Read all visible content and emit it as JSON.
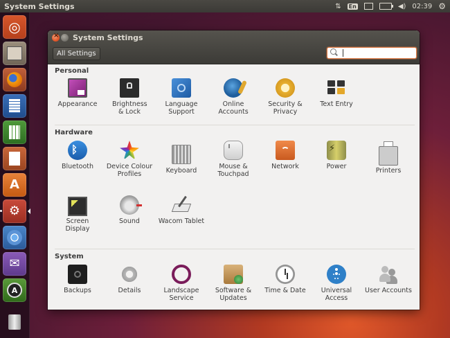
{
  "top_panel": {
    "title": "System Settings",
    "keyboard_layout": "En",
    "clock": "02:39"
  },
  "launcher": {
    "items": [
      {
        "name": "dash-home",
        "icon": "ubuntu-logo-icon"
      },
      {
        "name": "files",
        "icon": "file-cabinet-icon"
      },
      {
        "name": "firefox",
        "icon": "firefox-icon"
      },
      {
        "name": "libreoffice-writer",
        "icon": "document-icon"
      },
      {
        "name": "libreoffice-calc",
        "icon": "spreadsheet-icon"
      },
      {
        "name": "libreoffice-impress",
        "icon": "presentation-icon"
      },
      {
        "name": "ubuntu-software-center",
        "icon": "shopping-bag-icon"
      },
      {
        "name": "system-settings",
        "icon": "gear-wrench-icon"
      },
      {
        "name": "chromium",
        "icon": "chromium-icon"
      },
      {
        "name": "empathy",
        "icon": "chat-bird-icon"
      },
      {
        "name": "software-updater",
        "icon": "updater-icon"
      },
      {
        "name": "trash",
        "icon": "trash-icon"
      }
    ]
  },
  "window": {
    "title": "System Settings",
    "all_settings_label": "All Settings",
    "search": {
      "value": "",
      "placeholder": ""
    }
  },
  "sections": {
    "personal": {
      "title": "Personal",
      "items": [
        {
          "label": "Appearance",
          "icon": "appearance-icon"
        },
        {
          "label": "Brightness & Lock",
          "icon": "brightness-lock-icon"
        },
        {
          "label": "Language Support",
          "icon": "language-support-icon"
        },
        {
          "label": "Online Accounts",
          "icon": "online-accounts-icon"
        },
        {
          "label": "Security & Privacy",
          "icon": "security-privacy-icon"
        },
        {
          "label": "Text Entry",
          "icon": "text-entry-icon"
        }
      ]
    },
    "hardware": {
      "title": "Hardware",
      "items": [
        {
          "label": "Bluetooth",
          "icon": "bluetooth-icon"
        },
        {
          "label": "Device Colour Profiles",
          "icon": "color-profiles-icon"
        },
        {
          "label": "Keyboard",
          "icon": "keyboard-icon"
        },
        {
          "label": "Mouse & Touchpad",
          "icon": "mouse-icon"
        },
        {
          "label": "Network",
          "icon": "network-icon"
        },
        {
          "label": "Power",
          "icon": "power-icon"
        },
        {
          "label": "Printers",
          "icon": "printer-icon"
        },
        {
          "label": "Screen Display",
          "icon": "screen-display-icon"
        },
        {
          "label": "Sound",
          "icon": "sound-icon"
        },
        {
          "label": "Wacom Tablet",
          "icon": "wacom-tablet-icon"
        }
      ]
    },
    "system": {
      "title": "System",
      "items": [
        {
          "label": "Backups",
          "icon": "backups-icon"
        },
        {
          "label": "Details",
          "icon": "details-gear-icon"
        },
        {
          "label": "Landscape Service",
          "icon": "landscape-icon"
        },
        {
          "label": "Software & Updates",
          "icon": "software-updates-icon"
        },
        {
          "label": "Time & Date",
          "icon": "clock-icon"
        },
        {
          "label": "Universal Access",
          "icon": "universal-access-icon"
        },
        {
          "label": "User Accounts",
          "icon": "user-accounts-icon"
        }
      ]
    }
  }
}
